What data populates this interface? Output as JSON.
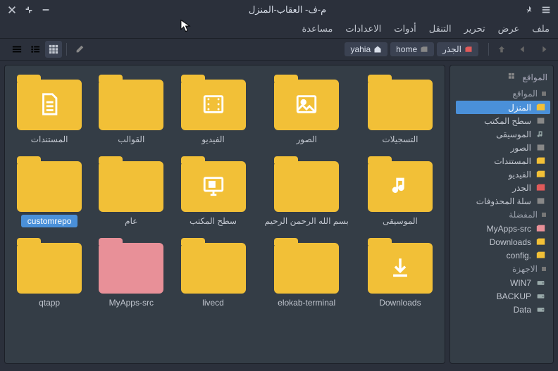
{
  "window": {
    "title": "م-ف- العقاب-المنزل"
  },
  "menubar": [
    "مساعدة",
    "الاعدادات",
    "أدوات",
    "التنقل",
    "تحرير",
    "عرض",
    "ملف"
  ],
  "breadcrumbs": [
    {
      "label": "yahia",
      "icon": "home"
    },
    {
      "label": "home",
      "icon": "folder"
    },
    {
      "label": "الجذر",
      "icon": "root"
    }
  ],
  "sidebar": {
    "head": "المواقع",
    "sections": [
      {
        "header": "المواقع",
        "items": [
          {
            "label": "المنزل",
            "icon": "folder",
            "active": true
          },
          {
            "label": "سطح المكتب",
            "icon": "dim"
          },
          {
            "label": "الموسيقى",
            "icon": "music"
          },
          {
            "label": "الصور",
            "icon": "dim"
          },
          {
            "label": "المستندات",
            "icon": "folder"
          },
          {
            "label": "الفيديو",
            "icon": "folder"
          },
          {
            "label": "الجذر",
            "icon": "folder-red"
          },
          {
            "label": "سلة المحذوفات",
            "icon": "dim"
          }
        ]
      },
      {
        "header": "المفضلة",
        "items": [
          {
            "label": "MyApps-src",
            "icon": "folder-pink"
          },
          {
            "label": "Downloads",
            "icon": "folder"
          },
          {
            "label": "config.",
            "icon": "folder"
          }
        ]
      },
      {
        "header": "الاجهزة",
        "items": [
          {
            "label": "WIN7",
            "icon": "drive"
          },
          {
            "label": "BACKUP",
            "icon": "drive"
          },
          {
            "label": "Data",
            "icon": "drive"
          }
        ]
      }
    ]
  },
  "items": [
    {
      "label": "المستندات",
      "glyph": "doc",
      "selected": false
    },
    {
      "label": "القوالب",
      "glyph": "",
      "selected": false
    },
    {
      "label": "الفيديو",
      "glyph": "video",
      "selected": false
    },
    {
      "label": "الصور",
      "glyph": "image",
      "selected": false
    },
    {
      "label": "التسجيلات",
      "glyph": "",
      "selected": false
    },
    {
      "label": "customrepo",
      "glyph": "",
      "selected": true
    },
    {
      "label": "عام",
      "glyph": "",
      "selected": false
    },
    {
      "label": "سطح المكتب",
      "glyph": "desktop",
      "selected": false
    },
    {
      "label": "بسم الله الرحمن الرحيم",
      "glyph": "",
      "selected": false
    },
    {
      "label": "الموسيقى",
      "glyph": "music",
      "selected": false
    },
    {
      "label": "qtapp",
      "glyph": "",
      "selected": false
    },
    {
      "label": "MyApps-src",
      "glyph": "",
      "selected": false,
      "pink": true
    },
    {
      "label": "livecd",
      "glyph": "",
      "selected": false
    },
    {
      "label": "elokab-terminal",
      "glyph": "",
      "selected": false
    },
    {
      "label": "Downloads",
      "glyph": "download",
      "selected": false
    }
  ]
}
